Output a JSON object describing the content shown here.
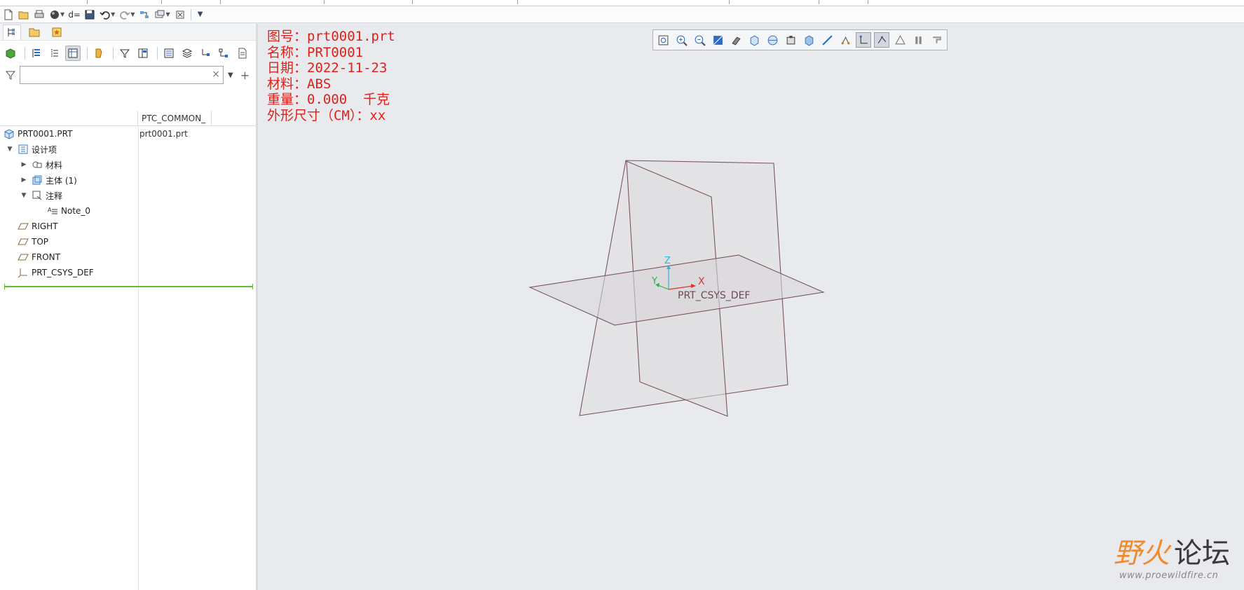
{
  "ribbon": {
    "separators": [
      124,
      230,
      314,
      462,
      588,
      738,
      1040,
      1168,
      1238
    ]
  },
  "quick_access": {
    "buttons": [
      "new-icon",
      "open-icon",
      "print-icon",
      "appearance-icon",
      "dimension-icon",
      "save-icon",
      "undo-icon",
      "redo-icon",
      "regenerate-icon",
      "windows-icon",
      "close-window-icon",
      "customize-icon"
    ]
  },
  "left_panel": {
    "search": {
      "value": "",
      "placeholder": ""
    },
    "column_header": "PTC_COMMON_",
    "tree": [
      {
        "label": "PRT0001.PRT",
        "value": "prt0001.prt",
        "icon": "part-icon",
        "expand": ""
      },
      {
        "label": "设计项",
        "value": "",
        "icon": "design-items-icon",
        "expand": "▼"
      },
      {
        "label": "材料",
        "value": "",
        "icon": "material-icon",
        "expand": "▶"
      },
      {
        "label": "主体 (1)",
        "value": "",
        "icon": "body-icon",
        "expand": "▶"
      },
      {
        "label": "注释",
        "value": "",
        "icon": "annotation-icon",
        "expand": "▼"
      },
      {
        "label": "Note_0",
        "value": "",
        "icon": "note-icon",
        "expand": ""
      },
      {
        "label": "RIGHT",
        "value": "",
        "icon": "datum-plane-icon",
        "expand": ""
      },
      {
        "label": "TOP",
        "value": "",
        "icon": "datum-plane-icon",
        "expand": ""
      },
      {
        "label": "FRONT",
        "value": "",
        "icon": "datum-plane-icon",
        "expand": ""
      },
      {
        "label": "PRT_CSYS_DEF",
        "value": "",
        "icon": "csys-icon",
        "expand": ""
      }
    ]
  },
  "graphics": {
    "note_lines": [
      "图号：prt0001.prt",
      "名称：PRT0001",
      "日期：2022-11-23",
      "材料：ABS",
      "重量：0.000  千克",
      "外形尺寸（CM）：xx"
    ],
    "csys_label": "PRT_CSYS_DEF",
    "axis_labels": {
      "x": "X",
      "y": "Y",
      "z": "Z"
    },
    "colors": {
      "note": "#e0201a",
      "plane_edge": "#7a5560",
      "x_axis": "#e03030",
      "y_axis": "#2bb24c",
      "z_axis": "#2fb7d6"
    }
  },
  "watermark": {
    "part1": "野火",
    "part2": "论坛",
    "url": "www.proewildfire.cn"
  }
}
